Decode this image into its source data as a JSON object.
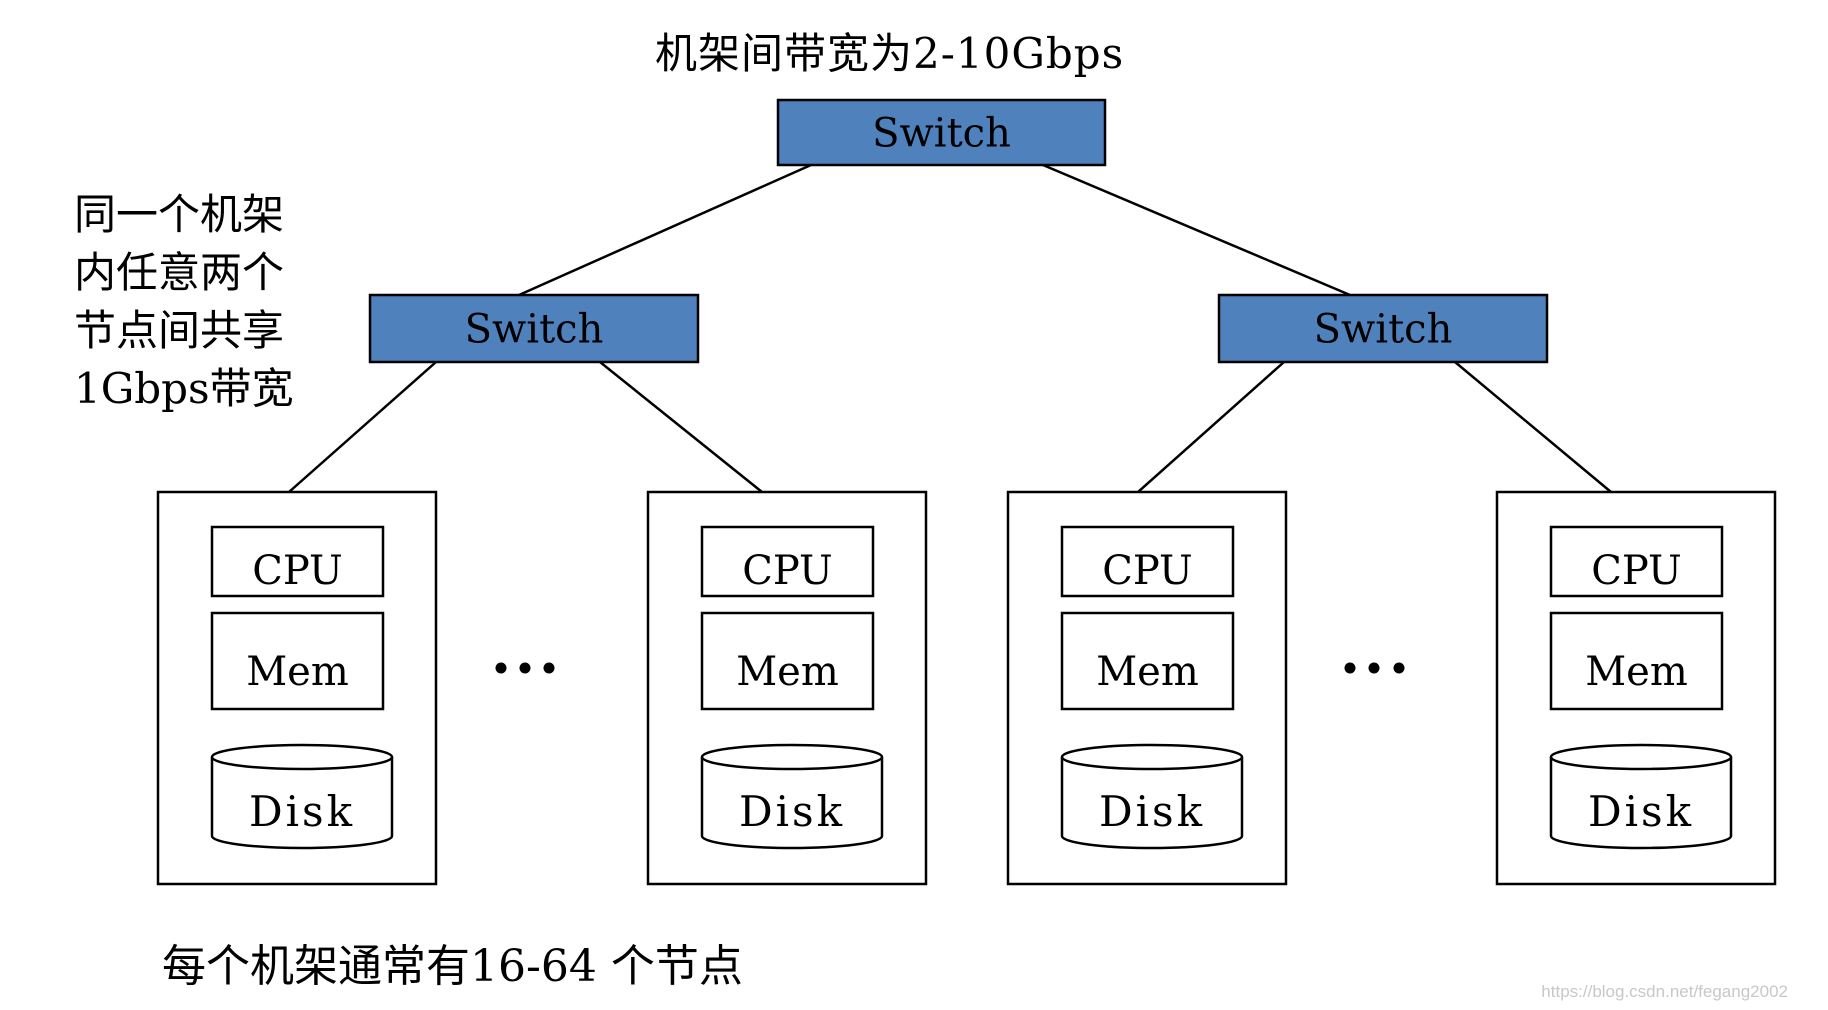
{
  "title": "机架间带宽为2-10Gbps",
  "left_note": {
    "lines": [
      "同一个机架",
      "内任意两个",
      "节点间共享",
      "1Gbps带宽"
    ]
  },
  "bottom_note": "每个机架通常有16-64 个节点",
  "watermark": "https://blog.csdn.net/fegang2002",
  "colors": {
    "switch_fill": "#4F81BD",
    "stroke": "#000000",
    "background": "#FFFFFF"
  },
  "switches": [
    {
      "id": "core",
      "label": "Switch"
    },
    {
      "id": "rack-left",
      "label": "Switch"
    },
    {
      "id": "rack-right",
      "label": "Switch"
    }
  ],
  "nodes": [
    {
      "rack": "rack-left",
      "cpu": "CPU",
      "mem": "Mem",
      "disk": "Disk"
    },
    {
      "rack": "rack-left",
      "cpu": "CPU",
      "mem": "Mem",
      "disk": "Disk"
    },
    {
      "rack": "rack-right",
      "cpu": "CPU",
      "mem": "Mem",
      "disk": "Disk"
    },
    {
      "rack": "rack-right",
      "cpu": "CPU",
      "mem": "Mem",
      "disk": "Disk"
    }
  ],
  "ellipsis": "•••",
  "links": [
    {
      "from": "core",
      "to": "rack-left"
    },
    {
      "from": "core",
      "to": "rack-right"
    },
    {
      "from": "rack-left",
      "to": "node-0"
    },
    {
      "from": "rack-left",
      "to": "node-1"
    },
    {
      "from": "rack-right",
      "to": "node-2"
    },
    {
      "from": "rack-right",
      "to": "node-3"
    }
  ]
}
